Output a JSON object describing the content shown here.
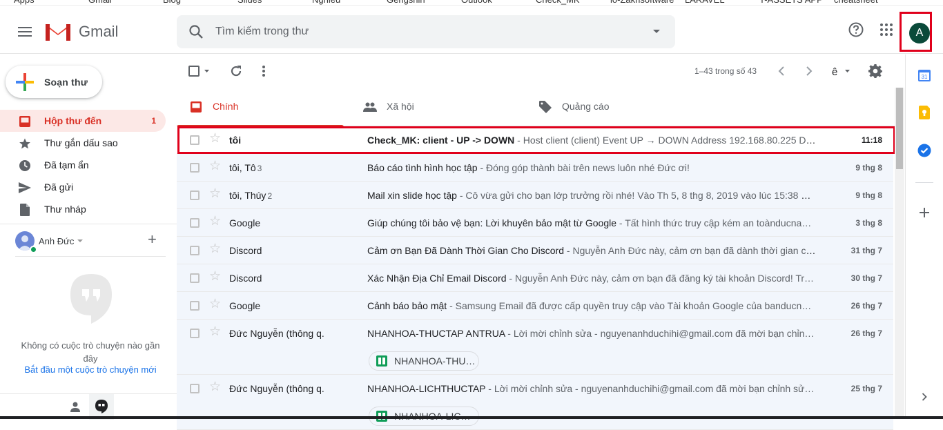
{
  "bookmarks": [
    "Apps",
    "Gmail",
    "Blog",
    "Slides",
    "Nghieu",
    "Gengshin",
    "Outlook",
    "Check_MK",
    "lo-Zakhsoftware",
    "LARAVEL",
    "T-ASSETS APP",
    "cheatsheet"
  ],
  "header": {
    "app_name": "Gmail",
    "search_placeholder": "Tìm kiếm trong thư",
    "avatar_letter": "A"
  },
  "compose": {
    "label": "Soạn thư"
  },
  "nav": [
    {
      "label": "Hộp thư đến",
      "count": "1",
      "icon": "inbox-icon",
      "active": true
    },
    {
      "label": "Thư gắn dấu sao",
      "count": "",
      "icon": "star-icon",
      "active": false
    },
    {
      "label": "Đã tạm ẩn",
      "count": "",
      "icon": "clock-icon",
      "active": false
    },
    {
      "label": "Đã gửi",
      "count": "",
      "icon": "send-icon",
      "active": false
    },
    {
      "label": "Thư nháp",
      "count": "",
      "icon": "draft-icon",
      "active": false
    }
  ],
  "hangouts": {
    "user_name": "Anh Đức",
    "empty_text": "Không có cuộc trò chuyện nào gần đây",
    "start_link": "Bắt đầu một cuộc trò chuyện mới"
  },
  "toolbar": {
    "pager": "1–43 trong số 43"
  },
  "tabs": [
    {
      "label": "Chính",
      "icon": "inbox-icon",
      "active": true
    },
    {
      "label": "Xã hội",
      "icon": "people-icon",
      "active": false
    },
    {
      "label": "Quảng cáo",
      "icon": "tag-icon",
      "active": false
    }
  ],
  "emails": [
    {
      "sender": "tôi",
      "count": "",
      "subject": "Check_MK: client - UP -> DOWN",
      "snippet": " - Host client (client) Event UP → DOWN Address 192.168.80.225 Da…",
      "date": "11:18",
      "unread": true,
      "attachment": ""
    },
    {
      "sender": "tôi, Tô",
      "count": "3",
      "subject": "Báo cáo tình hình học tập",
      "snippet": " - Đóng góp thành bài trên news luôn nhé Đức ơi!",
      "date": "9 thg 8",
      "unread": false,
      "attachment": ""
    },
    {
      "sender": "tôi, Thúy",
      "count": "2",
      "subject": "Mail xin slide học tập",
      "snippet": " - Cô vừa gửi cho bạn lớp trưởng rồi nhé! Vào Th 5, 8 thg 8, 2019 vào lúc 15:38 d…",
      "date": "9 thg 8",
      "unread": false,
      "attachment": ""
    },
    {
      "sender": "Google",
      "count": "",
      "subject": "Giúp chúng tôi bảo vệ bạn: Lời khuyên bảo mật từ Google",
      "snippet": " - Tất hình thức truy cập kém an toànducna…",
      "date": "3 thg 8",
      "unread": false,
      "attachment": ""
    },
    {
      "sender": "Discord",
      "count": "",
      "subject": "Cảm ơn Bạn Đã Dành Thời Gian Cho Discord",
      "snippet": " - Nguyễn Anh Đức này, cảm ơn bạn đã dành thời gian ch…",
      "date": "31 thg 7",
      "unread": false,
      "attachment": ""
    },
    {
      "sender": "Discord",
      "count": "",
      "subject": "Xác Nhận Địa Chỉ Email Discord",
      "snippet": " - Nguyễn Anh Đức này, cảm ơn bạn đã đăng ký tài khoản Discord! Tr…",
      "date": "30 thg 7",
      "unread": false,
      "attachment": ""
    },
    {
      "sender": "Google",
      "count": "",
      "subject": "Cảnh báo bảo mật",
      "snippet": " - Samsung Email đã được cấp quyền truy cập vào Tài khoản Google của banducn…",
      "date": "26 thg 7",
      "unread": false,
      "attachment": ""
    },
    {
      "sender": "Đức Nguyễn (thông q.",
      "count": "",
      "subject": "NHANHOA-THUCTAP ANTRUA",
      "snippet": " - Lời mời chỉnh sửa - nguyenanhduchihi@gmail.com đã mời bạn chỉn…",
      "date": "26 thg 7",
      "unread": false,
      "attachment": "NHANHOA-THU…"
    },
    {
      "sender": "Đức Nguyễn (thông q.",
      "count": "",
      "subject": "NHANHOA-LICHTHUCTAP",
      "snippet": " - Lời mời chỉnh sửa - nguyenanhduchihi@gmail.com đã mời bạn chỉnh sử…",
      "date": "25 thg 7",
      "unread": false,
      "attachment": "NHANHOA-LIC…"
    }
  ],
  "colors": {
    "accent": "#d93025",
    "highlight": "#e0001b"
  }
}
